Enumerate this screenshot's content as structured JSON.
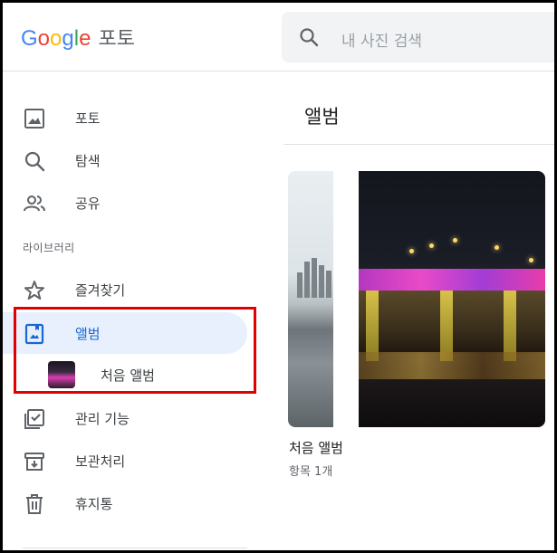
{
  "header": {
    "logo_letters": [
      "G",
      "o",
      "o",
      "g",
      "l",
      "e"
    ],
    "product_name": "포토",
    "search_placeholder": "내 사진 검색",
    "search_icon": "search-icon"
  },
  "sidebar": {
    "items": [
      {
        "label": "포토",
        "icon": "photo-icon"
      },
      {
        "label": "탐색",
        "icon": "search-icon"
      },
      {
        "label": "공유",
        "icon": "people-icon"
      }
    ],
    "library_label": "라이브러리",
    "library_items": [
      {
        "label": "즐겨찾기",
        "icon": "star-icon"
      },
      {
        "label": "앨범",
        "icon": "album-icon",
        "active": true
      }
    ],
    "sub_album_label": "처음 앨범",
    "bottom_items": [
      {
        "label": "관리 기능",
        "icon": "checklist-icon"
      },
      {
        "label": "보관처리",
        "icon": "archive-icon"
      },
      {
        "label": "휴지통",
        "icon": "trash-icon"
      }
    ]
  },
  "main": {
    "title": "앨범",
    "albums": [
      {
        "title": "처음 앨범",
        "count": "항목 1개"
      }
    ]
  },
  "colors": {
    "accent": "#1a73e8",
    "active_bg": "#e8f0fe",
    "highlight": "#e00000"
  }
}
